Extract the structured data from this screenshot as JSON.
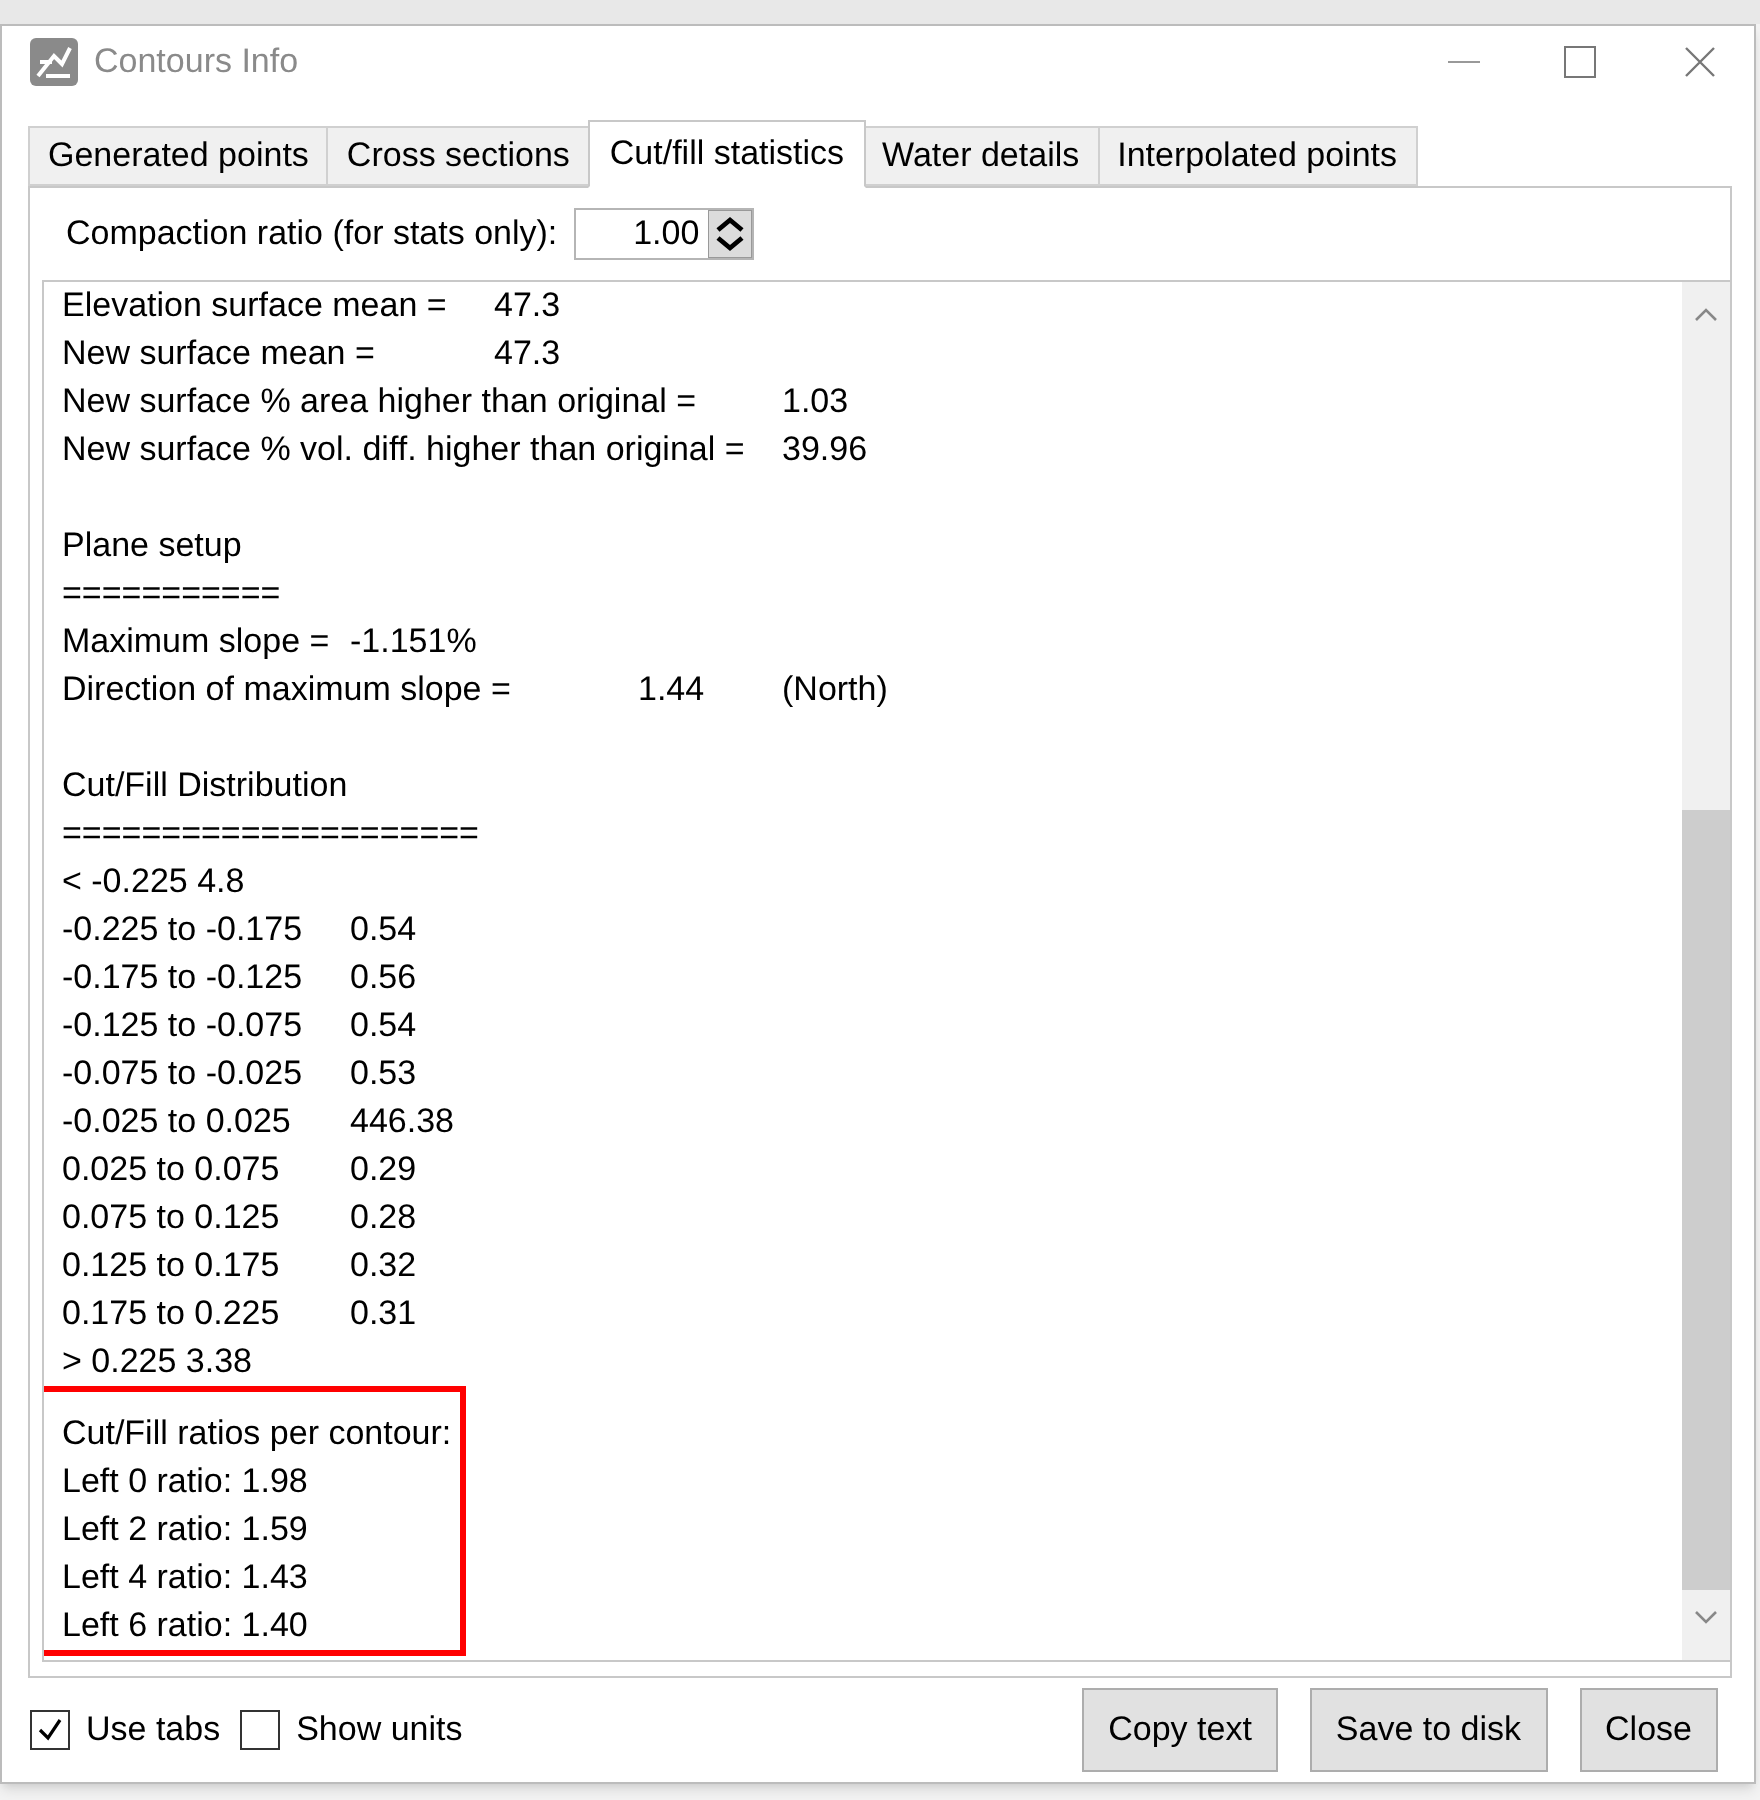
{
  "window": {
    "title": "Contours Info"
  },
  "tabs": [
    {
      "label": "Generated points",
      "selected": false
    },
    {
      "label": "Cross sections",
      "selected": false
    },
    {
      "label": "Cut/fill statistics",
      "selected": true
    },
    {
      "label": "Water details",
      "selected": false
    },
    {
      "label": "Interpolated points",
      "selected": false
    }
  ],
  "compaction": {
    "label": "Compaction ratio (for stats only):",
    "value": "1.00"
  },
  "report": {
    "sections": [
      {
        "highlighted": false,
        "lines": [
          "Elevation surface mean =\t47.3",
          "New surface mean =\t47.3",
          "New surface % area higher than original =\t1.03",
          "New surface % vol. diff. higher than original =\t39.96"
        ]
      },
      {
        "highlighted": false,
        "lines": [
          "Plane setup",
          "===========",
          "Maximum slope =\t-1.151%",
          "Direction of maximum slope =\t1.44\t(North)"
        ]
      },
      {
        "highlighted": false,
        "lines": [
          "Cut/Fill Distribution",
          "=====================",
          "< -0.225 4.8",
          "-0.225 to -0.175\t0.54",
          "-0.175 to -0.125\t0.56",
          "-0.125 to -0.075\t0.54",
          "-0.075 to -0.025\t0.53",
          "-0.025 to 0.025\t446.38",
          "0.025 to 0.075\t0.29",
          "0.075 to 0.125\t0.28",
          "0.125 to 0.175\t0.32",
          "0.175 to 0.225\t0.31",
          "> 0.225 3.38"
        ]
      },
      {
        "highlighted": true,
        "lines": [
          "Cut/Fill ratios per contour:",
          "Left 0 ratio: 1.98",
          "Left 2 ratio: 1.59",
          "Left 4 ratio: 1.43",
          "Left 6 ratio: 1.40"
        ]
      }
    ]
  },
  "options": [
    {
      "label": "Use tabs",
      "checked": true
    },
    {
      "label": "Show units",
      "checked": false
    }
  ],
  "buttons": [
    "Copy text",
    "Save to disk",
    "Close"
  ]
}
